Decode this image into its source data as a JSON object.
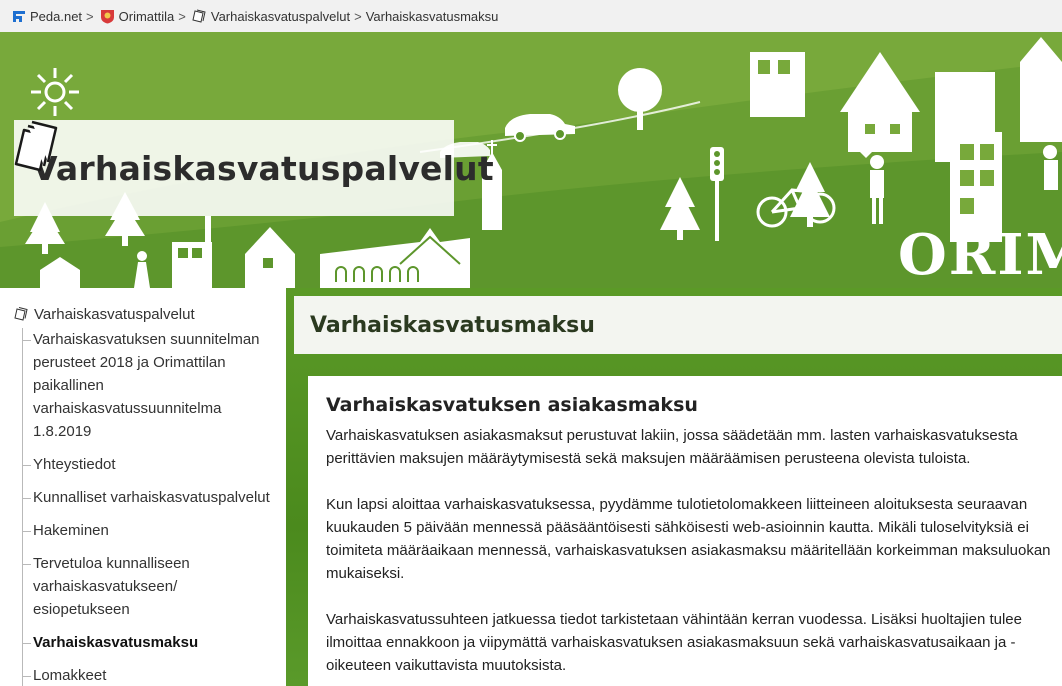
{
  "breadcrumb": {
    "items": [
      "Peda.net",
      "Orimattila",
      "Varhaiskasvatuspalvelut",
      "Varhaiskasvatusmaksu"
    ],
    "separator": ">"
  },
  "banner": {
    "site_title": "Varhaiskasvatuspalvelut",
    "town_text": "ORIM",
    "colors": {
      "banner_green": "#7aab3e",
      "hill_green": "#5f9a2c",
      "dark_green": "#4a8a1e"
    }
  },
  "sidebar": {
    "root_label": "Varhaiskasvatuspalvelut",
    "items": [
      {
        "label": "Varhaiskasvatuksen suunnitelman perusteet 2018 ja Orimattilan paikallinen varhaiskasvatussuunnitelma 1.8.2019",
        "lines": [
          "Varhaiskasvatuksen suunnitelman",
          "perusteet 2018 ja Orimattilan",
          "paikallinen",
          "varhaiskasvatussuunnitelma",
          "1.8.2019"
        ]
      },
      {
        "label": "Yhteystiedot"
      },
      {
        "label": "Kunnalliset varhaiskasvatuspalvelut"
      },
      {
        "label": "Hakeminen"
      },
      {
        "label": "Tervetuloa kunnalliseen varhaiskasvatukseen/ esiopetukseen",
        "lines": [
          "Tervetuloa kunnalliseen",
          "varhaiskasvatukseen/",
          "esiopetukseen"
        ]
      },
      {
        "label": "Varhaiskasvatusmaksu",
        "active": true
      },
      {
        "label": "Lomakkeet"
      }
    ]
  },
  "main": {
    "page_heading": "Varhaiskasvatusmaksu",
    "content_title": "Varhaiskasvatuksen asiakasmaksu",
    "paragraphs": [
      [
        "Varhaiskasvatuksen asiakasmaksut perustuvat lakiin, jossa säädetään mm. lasten varhaiskasvatuksesta",
        "perittävien maksujen määräytymisestä sekä maksujen määräämisen perusteena olevista tuloista."
      ],
      [
        "Kun lapsi aloittaa varhaiskasvatuksessa, pyydämme tulotietolomakkeen liitteineen aloituksesta seuraavan",
        "kuukauden 5 päivään mennessä pääsääntöisesti sähköisesti web-asioinnin kautta. Mikäli tuloselvityksiä ei",
        "toimiteta määräaikaan mennessä, varhaiskasvatuksen asiakasmaksu määritellään korkeimman maksuluokan",
        "mukaiseksi."
      ],
      [
        "Varhaiskasvatussuhteen jatkuessa tiedot tarkistetaan vähintään kerran vuodessa. Lisäksi huoltajien tulee",
        "ilmoittaa ennakkoon ja viipymättä varhaiskasvatuksen asiakasmaksuun sekä varhaiskasvatusaikaan ja -",
        "oikeuteen vaikuttavista muutoksista."
      ]
    ]
  },
  "icons": {
    "peda_logo": "peda-net-logo-icon",
    "orimattila_crest": "orimattila-crest-icon",
    "leaf_book": "book-pages-icon"
  }
}
